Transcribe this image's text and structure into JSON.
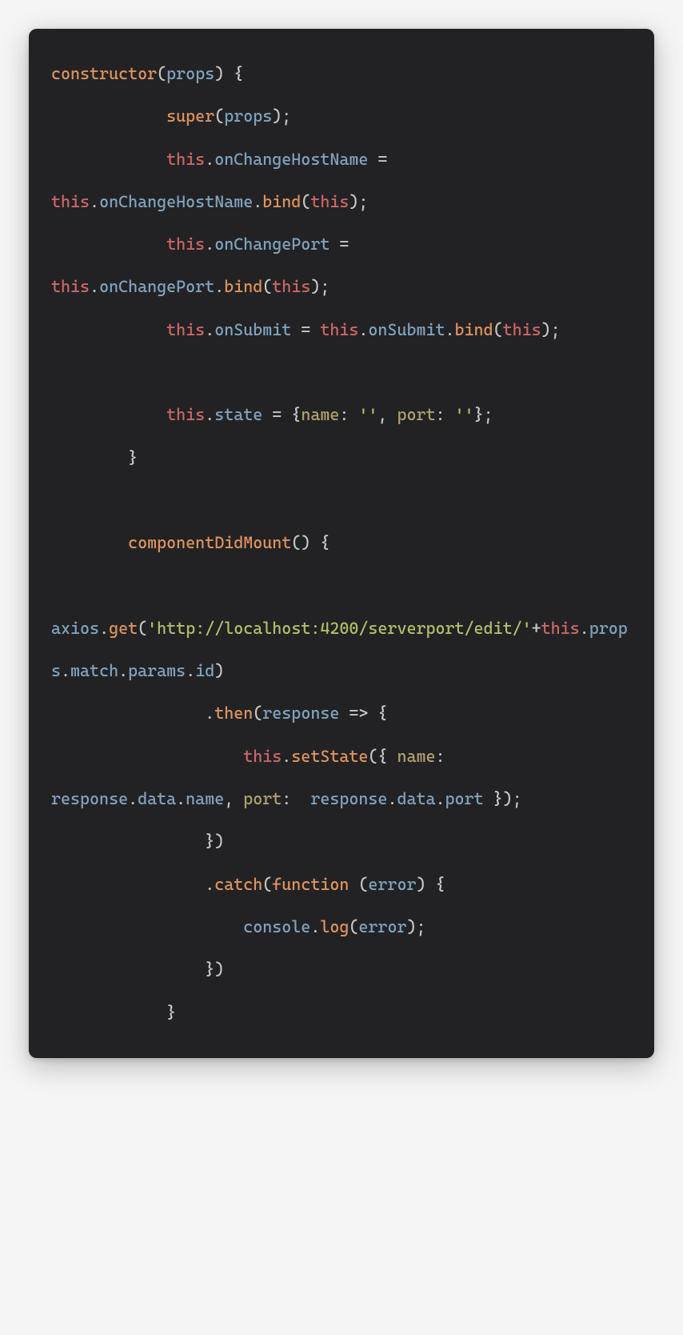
{
  "tokens": [
    {
      "t": "constructor",
      "c": "kw"
    },
    {
      "t": "(",
      "c": "punc"
    },
    {
      "t": "props",
      "c": "id"
    },
    {
      "t": ") {",
      "c": "punc"
    },
    {
      "t": "\n",
      "c": "plain"
    },
    {
      "t": "            ",
      "c": "plain"
    },
    {
      "t": "super",
      "c": "fn"
    },
    {
      "t": "(",
      "c": "punc"
    },
    {
      "t": "props",
      "c": "id"
    },
    {
      "t": ");",
      "c": "punc"
    },
    {
      "t": "\n",
      "c": "plain"
    },
    {
      "t": "            ",
      "c": "plain"
    },
    {
      "t": "this",
      "c": "this"
    },
    {
      "t": ".",
      "c": "punc"
    },
    {
      "t": "onChangeHostName",
      "c": "id"
    },
    {
      "t": " = ",
      "c": "punc"
    },
    {
      "t": "this",
      "c": "this"
    },
    {
      "t": ".",
      "c": "punc"
    },
    {
      "t": "onChangeHostName",
      "c": "id"
    },
    {
      "t": ".",
      "c": "punc"
    },
    {
      "t": "bind",
      "c": "fn"
    },
    {
      "t": "(",
      "c": "punc"
    },
    {
      "t": "this",
      "c": "this"
    },
    {
      "t": ");",
      "c": "punc"
    },
    {
      "t": "\n",
      "c": "plain"
    },
    {
      "t": "            ",
      "c": "plain"
    },
    {
      "t": "this",
      "c": "this"
    },
    {
      "t": ".",
      "c": "punc"
    },
    {
      "t": "onChangePort",
      "c": "id"
    },
    {
      "t": " = ",
      "c": "punc"
    },
    {
      "t": "this",
      "c": "this"
    },
    {
      "t": ".",
      "c": "punc"
    },
    {
      "t": "onChangePort",
      "c": "id"
    },
    {
      "t": ".",
      "c": "punc"
    },
    {
      "t": "bind",
      "c": "fn"
    },
    {
      "t": "(",
      "c": "punc"
    },
    {
      "t": "this",
      "c": "this"
    },
    {
      "t": ");",
      "c": "punc"
    },
    {
      "t": "\n",
      "c": "plain"
    },
    {
      "t": "            ",
      "c": "plain"
    },
    {
      "t": "this",
      "c": "this"
    },
    {
      "t": ".",
      "c": "punc"
    },
    {
      "t": "onSubmit",
      "c": "id"
    },
    {
      "t": " = ",
      "c": "punc"
    },
    {
      "t": "this",
      "c": "this"
    },
    {
      "t": ".",
      "c": "punc"
    },
    {
      "t": "onSubmit",
      "c": "id"
    },
    {
      "t": ".",
      "c": "punc"
    },
    {
      "t": "bind",
      "c": "fn"
    },
    {
      "t": "(",
      "c": "punc"
    },
    {
      "t": "this",
      "c": "this"
    },
    {
      "t": ");",
      "c": "punc"
    },
    {
      "t": "\n",
      "c": "plain"
    },
    {
      "t": "\n",
      "c": "plain"
    },
    {
      "t": "            ",
      "c": "plain"
    },
    {
      "t": "this",
      "c": "this"
    },
    {
      "t": ".",
      "c": "punc"
    },
    {
      "t": "state",
      "c": "id"
    },
    {
      "t": " = {",
      "c": "punc"
    },
    {
      "t": "name",
      "c": "prop"
    },
    {
      "t": ": ",
      "c": "punc"
    },
    {
      "t": "''",
      "c": "str"
    },
    {
      "t": ", ",
      "c": "punc"
    },
    {
      "t": "port",
      "c": "prop"
    },
    {
      "t": ": ",
      "c": "punc"
    },
    {
      "t": "''",
      "c": "str"
    },
    {
      "t": "};",
      "c": "punc"
    },
    {
      "t": "\n",
      "c": "plain"
    },
    {
      "t": "        }",
      "c": "punc"
    },
    {
      "t": "\n",
      "c": "plain"
    },
    {
      "t": "\n",
      "c": "plain"
    },
    {
      "t": "        ",
      "c": "plain"
    },
    {
      "t": "componentDidMount",
      "c": "fn"
    },
    {
      "t": "() {",
      "c": "punc"
    },
    {
      "t": "\n",
      "c": "plain"
    },
    {
      "t": "            ",
      "c": "plain"
    },
    {
      "t": "axios",
      "c": "id"
    },
    {
      "t": ".",
      "c": "punc"
    },
    {
      "t": "get",
      "c": "fn"
    },
    {
      "t": "(",
      "c": "punc"
    },
    {
      "t": "'http://localhost:4200/serverport/edit/'",
      "c": "str"
    },
    {
      "t": "+",
      "c": "punc"
    },
    {
      "t": "this",
      "c": "this"
    },
    {
      "t": ".",
      "c": "punc"
    },
    {
      "t": "props",
      "c": "id"
    },
    {
      "t": ".",
      "c": "punc"
    },
    {
      "t": "match",
      "c": "id"
    },
    {
      "t": ".",
      "c": "punc"
    },
    {
      "t": "params",
      "c": "id"
    },
    {
      "t": ".",
      "c": "punc"
    },
    {
      "t": "id",
      "c": "id"
    },
    {
      "t": ")",
      "c": "punc"
    },
    {
      "t": "\n",
      "c": "plain"
    },
    {
      "t": "                .",
      "c": "punc"
    },
    {
      "t": "then",
      "c": "fn"
    },
    {
      "t": "(",
      "c": "punc"
    },
    {
      "t": "response",
      "c": "id"
    },
    {
      "t": " => {",
      "c": "punc"
    },
    {
      "t": "\n",
      "c": "plain"
    },
    {
      "t": "                    ",
      "c": "plain"
    },
    {
      "t": "this",
      "c": "this"
    },
    {
      "t": ".",
      "c": "punc"
    },
    {
      "t": "setState",
      "c": "fn"
    },
    {
      "t": "({ ",
      "c": "punc"
    },
    {
      "t": "name",
      "c": "prop"
    },
    {
      "t": ": ",
      "c": "punc"
    },
    {
      "t": " response",
      "c": "id"
    },
    {
      "t": ".",
      "c": "punc"
    },
    {
      "t": "data",
      "c": "id"
    },
    {
      "t": ".",
      "c": "punc"
    },
    {
      "t": "name",
      "c": "id"
    },
    {
      "t": ", ",
      "c": "punc"
    },
    {
      "t": "port",
      "c": "prop"
    },
    {
      "t": ": ",
      "c": "punc"
    },
    {
      "t": " response",
      "c": "id"
    },
    {
      "t": ".",
      "c": "punc"
    },
    {
      "t": "data",
      "c": "id"
    },
    {
      "t": ".",
      "c": "punc"
    },
    {
      "t": "port",
      "c": "id"
    },
    {
      "t": " });",
      "c": "punc"
    },
    {
      "t": "\n",
      "c": "plain"
    },
    {
      "t": "                })",
      "c": "punc"
    },
    {
      "t": "\n",
      "c": "plain"
    },
    {
      "t": "                .",
      "c": "punc"
    },
    {
      "t": "catch",
      "c": "fn"
    },
    {
      "t": "(",
      "c": "punc"
    },
    {
      "t": "function",
      "c": "kw"
    },
    {
      "t": " (",
      "c": "punc"
    },
    {
      "t": "error",
      "c": "id"
    },
    {
      "t": ") {",
      "c": "punc"
    },
    {
      "t": "\n",
      "c": "plain"
    },
    {
      "t": "                    ",
      "c": "plain"
    },
    {
      "t": "console",
      "c": "id"
    },
    {
      "t": ".",
      "c": "punc"
    },
    {
      "t": "log",
      "c": "fn"
    },
    {
      "t": "(",
      "c": "punc"
    },
    {
      "t": "error",
      "c": "id"
    },
    {
      "t": ");",
      "c": "punc"
    },
    {
      "t": "\n",
      "c": "plain"
    },
    {
      "t": "                })",
      "c": "punc"
    },
    {
      "t": "\n",
      "c": "plain"
    },
    {
      "t": "            }",
      "c": "punc"
    }
  ]
}
